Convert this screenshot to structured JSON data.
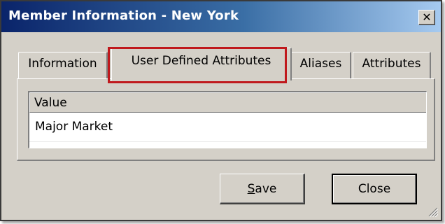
{
  "window": {
    "title": "Member Information - New York",
    "close_glyph": "✕"
  },
  "tabs": [
    {
      "label": "Information",
      "selected": false
    },
    {
      "label": "User Defined Attributes",
      "selected": true
    },
    {
      "label": "Aliases",
      "selected": false
    },
    {
      "label": "Attributes",
      "selected": false
    }
  ],
  "grid": {
    "header": "Value",
    "rows": [
      "Major Market"
    ]
  },
  "buttons": {
    "save_accel": "S",
    "save_rest": "ave",
    "close": "Close"
  },
  "colors": {
    "highlight": "#c0191d",
    "title_bar_start": "#0a246a",
    "title_bar_end": "#a6caf0",
    "dialog_bg": "#d4d0c8"
  }
}
